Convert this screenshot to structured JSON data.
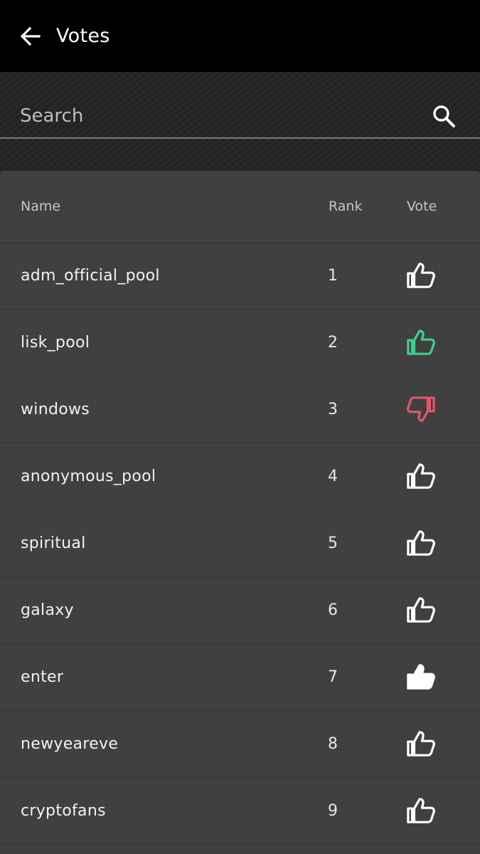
{
  "appbar": {
    "title": "Votes",
    "back_icon": "arrow-left-icon"
  },
  "search": {
    "placeholder": "Search",
    "value": "",
    "icon": "search-icon"
  },
  "colors": {
    "upvote_active": "#3ecf8e",
    "downvote_active": "#e2566e",
    "neutral": "#ffffff"
  },
  "table": {
    "columns": [
      "Name",
      "Rank",
      "Vote"
    ],
    "rows": [
      {
        "name": "adm_official_pool",
        "rank": "1",
        "vote_state": "upvote-outline"
      },
      {
        "name": "lisk_pool",
        "rank": "2",
        "vote_state": "upvote-green"
      },
      {
        "name": "windows",
        "rank": "3",
        "vote_state": "downvote-red"
      },
      {
        "name": "anonymous_pool",
        "rank": "4",
        "vote_state": "upvote-outline"
      },
      {
        "name": "spiritual",
        "rank": "5",
        "vote_state": "upvote-outline"
      },
      {
        "name": "galaxy",
        "rank": "6",
        "vote_state": "upvote-outline"
      },
      {
        "name": "enter",
        "rank": "7",
        "vote_state": "upvote-filled"
      },
      {
        "name": "newyeareve",
        "rank": "8",
        "vote_state": "upvote-outline"
      },
      {
        "name": "cryptofans",
        "rank": "9",
        "vote_state": "upvote-outline"
      }
    ]
  }
}
